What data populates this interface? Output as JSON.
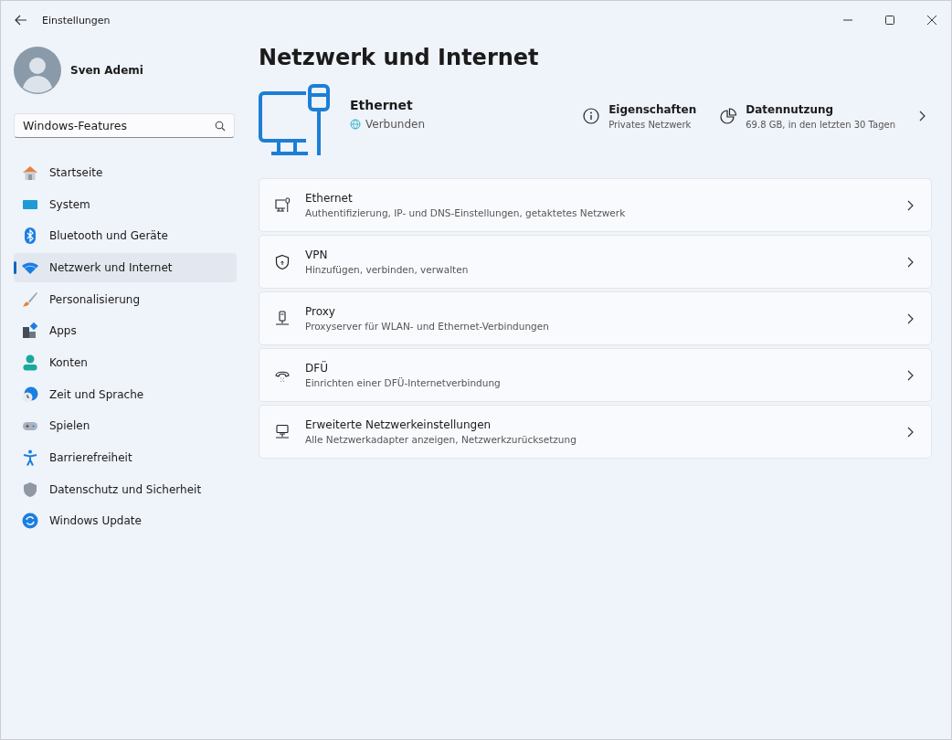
{
  "window": {
    "title": "Einstellungen"
  },
  "user": {
    "name": "Sven Ademi"
  },
  "search": {
    "value": "Windows-Features"
  },
  "sidebar": {
    "items": [
      {
        "label": "Startseite",
        "kind": "home",
        "selected": false
      },
      {
        "label": "System",
        "kind": "system",
        "selected": false
      },
      {
        "label": "Bluetooth und Geräte",
        "kind": "bluetooth",
        "selected": false
      },
      {
        "label": "Netzwerk und Internet",
        "kind": "network",
        "selected": true
      },
      {
        "label": "Personalisierung",
        "kind": "brush",
        "selected": false
      },
      {
        "label": "Apps",
        "kind": "apps",
        "selected": false
      },
      {
        "label": "Konten",
        "kind": "account",
        "selected": false
      },
      {
        "label": "Zeit und Sprache",
        "kind": "time",
        "selected": false
      },
      {
        "label": "Spielen",
        "kind": "gaming",
        "selected": false
      },
      {
        "label": "Barrierefreiheit",
        "kind": "accessibility",
        "selected": false
      },
      {
        "label": "Datenschutz und Sicherheit",
        "kind": "shield",
        "selected": false
      },
      {
        "label": "Windows Update",
        "kind": "update",
        "selected": false
      }
    ]
  },
  "page": {
    "title": "Netzwerk und Internet"
  },
  "connection": {
    "name": "Ethernet",
    "status": "Verbunden"
  },
  "info": [
    {
      "kind": "properties",
      "title": "Eigenschaften",
      "subtitle": "Privates Netzwerk"
    },
    {
      "kind": "usage",
      "title": "Datennutzung",
      "subtitle": "69.8 GB, in den letzten 30 Tagen"
    }
  ],
  "cards": [
    {
      "kind": "ethernet",
      "title": "Ethernet",
      "subtitle": "Authentifizierung, IP- und DNS-Einstellungen, getaktetes Netzwerk"
    },
    {
      "kind": "vpn",
      "title": "VPN",
      "subtitle": "Hinzufügen, verbinden, verwalten"
    },
    {
      "kind": "proxy",
      "title": "Proxy",
      "subtitle": "Proxyserver für WLAN- und Ethernet-Verbindungen"
    },
    {
      "kind": "dialup",
      "title": "DFÜ",
      "subtitle": "Einrichten einer DFÜ-Internetverbindung"
    },
    {
      "kind": "advanced",
      "title": "Erweiterte Netzwerkeinstellungen",
      "subtitle": "Alle Netzwerkadapter anzeigen, Netzwerkzurücksetzung"
    }
  ]
}
